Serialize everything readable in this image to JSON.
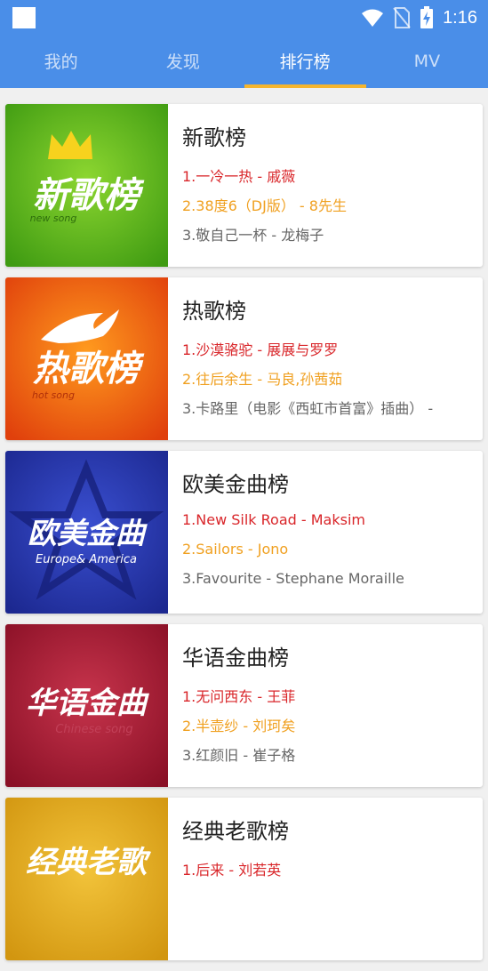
{
  "status_bar": {
    "time": "1:16"
  },
  "tabs": [
    {
      "label": "我的"
    },
    {
      "label": "发现"
    },
    {
      "label": "排行榜"
    },
    {
      "label": "MV"
    }
  ],
  "active_tab": 2,
  "charts": [
    {
      "title": "新歌榜",
      "cover_cn": "新歌榜",
      "cover_en": "new song",
      "tracks": [
        "1.一冷一热 - 戚薇",
        "2.38度6（DJ版） - 8先生",
        "3.敬自己一杯 - 龙梅子"
      ]
    },
    {
      "title": "热歌榜",
      "cover_cn": "热歌榜",
      "cover_en": "hot song",
      "tracks": [
        "1.沙漠骆驼 - 展展与罗罗",
        "2.往后余生 - 马良,孙茜茹",
        "3.卡路里（电影《西虹市首富》插曲） -"
      ]
    },
    {
      "title": "欧美金曲榜",
      "cover_cn": "欧美金曲",
      "cover_en": "Europe& America",
      "tracks": [
        "1.New Silk Road - Maksim",
        "2.Sailors - Jono",
        "3.Favourite - Stephane Moraille"
      ]
    },
    {
      "title": "华语金曲榜",
      "cover_cn": "华语金曲",
      "cover_en": "Chinese song",
      "tracks": [
        "1.无问西东 - 王菲",
        "2.半壶纱 - 刘珂矣",
        "3.红颜旧 - 崔子格"
      ]
    },
    {
      "title": "经典老歌榜",
      "cover_cn": "经典老歌",
      "cover_en": "",
      "tracks": [
        "1.后来 - 刘若英",
        "",
        ""
      ]
    }
  ],
  "colors": {
    "header": "#4a8ee8",
    "tab_indicator": "#f5b52e",
    "rank1": "#d9262a",
    "rank2": "#f0a020",
    "rank3": "#666666"
  }
}
